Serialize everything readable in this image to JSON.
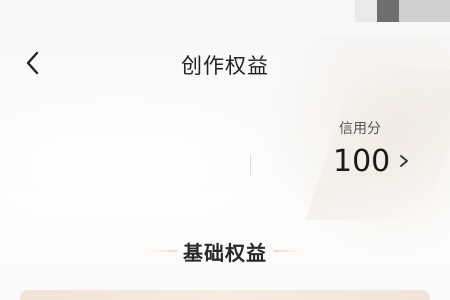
{
  "header": {
    "title": "创作权益",
    "back_icon": "chevron-left-icon"
  },
  "credit": {
    "label": "信用分",
    "value": "100",
    "chevron_icon": "chevron-right-icon"
  },
  "section": {
    "title": "基础权益"
  },
  "colors": {
    "accent_line": "#e7dccd",
    "card_gradient": "#efe3d5"
  }
}
